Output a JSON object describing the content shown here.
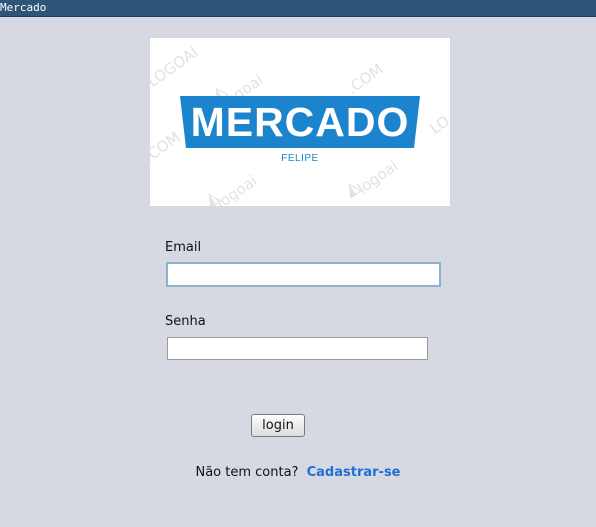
{
  "window": {
    "title": "Mercado"
  },
  "logo": {
    "brand": "MERCADO",
    "subtitle": "FELIPE",
    "watermark": [
      "logoai",
      "logoai",
      "logoai",
      ".COM",
      ".COM",
      "LO",
      "LOGOAI"
    ],
    "colors": {
      "banner": "#1c84cc",
      "background": "#ffffff"
    }
  },
  "form": {
    "email": {
      "label": "Email",
      "value": "",
      "placeholder": ""
    },
    "senha": {
      "label": "Senha",
      "value": "",
      "placeholder": ""
    },
    "login_button": "login"
  },
  "footer": {
    "prompt": "Não tem conta?",
    "signup_link": "Cadastrar-se"
  },
  "theme": {
    "window_bg": "#d6d9e1",
    "titlebar_bg": "#2c5578",
    "link": "#1f6fd6"
  }
}
